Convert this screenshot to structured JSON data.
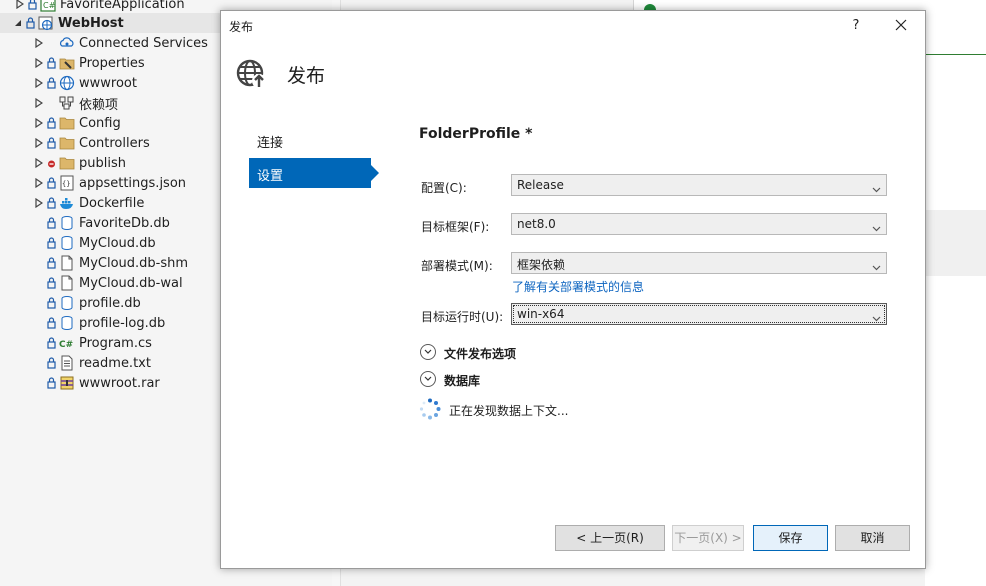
{
  "explorer": {
    "items": [
      {
        "label": "FavoriteApplication",
        "icon": "csharp-project-icon"
      },
      {
        "label": "WebHost",
        "icon": "web-project-icon"
      },
      {
        "label": "Connected Services",
        "icon": "connected-services-icon"
      },
      {
        "label": "Properties",
        "icon": "properties-icon"
      },
      {
        "label": "wwwroot",
        "icon": "globe-icon"
      },
      {
        "label": "依赖项",
        "icon": "dependencies-icon"
      },
      {
        "label": "Config",
        "icon": "folder-icon"
      },
      {
        "label": "Controllers",
        "icon": "folder-icon"
      },
      {
        "label": "publish",
        "icon": "folder-icon"
      },
      {
        "label": "appsettings.json",
        "icon": "json-file-icon"
      },
      {
        "label": "Dockerfile",
        "icon": "docker-icon"
      },
      {
        "label": "FavoriteDb.db",
        "icon": "database-file-icon"
      },
      {
        "label": "MyCloud.db",
        "icon": "database-file-icon"
      },
      {
        "label": "MyCloud.db-shm",
        "icon": "file-icon"
      },
      {
        "label": "MyCloud.db-wal",
        "icon": "file-icon"
      },
      {
        "label": "profile.db",
        "icon": "database-file-icon"
      },
      {
        "label": "profile-log.db",
        "icon": "database-file-icon"
      },
      {
        "label": "Program.cs",
        "icon": "csharp-file-icon"
      },
      {
        "label": "readme.txt",
        "icon": "text-file-icon"
      },
      {
        "label": "wwwroot.rar",
        "icon": "archive-icon"
      }
    ]
  },
  "dialog": {
    "title": "发布",
    "help": "?",
    "header_title": "发布",
    "nav": {
      "connect": "连接",
      "settings": "设置"
    },
    "profile_title": "FolderProfile *",
    "fields": {
      "config_label": "配置(C):",
      "config_value": "Release",
      "framework_label": "目标框架(F):",
      "framework_value": "net8.0",
      "deploy_label": "部署模式(M):",
      "deploy_value": "框架依赖",
      "deploy_link": "了解有关部署模式的信息",
      "runtime_label": "目标运行时(U):",
      "runtime_value": "win-x64"
    },
    "expanders": {
      "file_publish": "文件发布选项",
      "database": "数据库"
    },
    "discovering": "正在发现数据上下文...",
    "buttons": {
      "prev": "< 上一页(R)",
      "next": "下一页(X) >",
      "save": "保存",
      "cancel": "取消"
    },
    "colors": {
      "accent": "#0067b8",
      "link": "#0e65c0"
    }
  }
}
